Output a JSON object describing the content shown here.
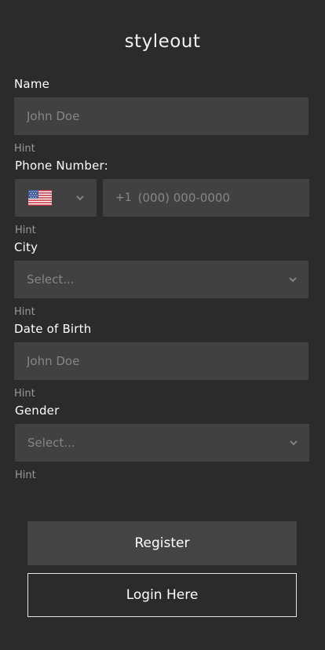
{
  "brand": "styleout",
  "form": {
    "name": {
      "label": "Name",
      "placeholder": "John Doe",
      "hint": "Hint"
    },
    "phone": {
      "label": "Phone Number:",
      "country_prefix": "+1",
      "placeholder": "(000) 000-0000",
      "hint": "Hint",
      "country_flag": "us-flag-icon"
    },
    "city": {
      "label": "City",
      "placeholder": "Select...",
      "hint": "Hint"
    },
    "dob": {
      "label": "Date of Birth",
      "placeholder": "John Doe",
      "hint": "Hint"
    },
    "gender": {
      "label": "Gender",
      "placeholder": "Select...",
      "hint": "Hint"
    }
  },
  "actions": {
    "register_label": "Register",
    "login_label": "Login Here"
  },
  "colors": {
    "background": "#2b2b2b",
    "field": "#414141",
    "button": "#444444",
    "text": "#ffffff",
    "muted": "#9a9a9a"
  }
}
